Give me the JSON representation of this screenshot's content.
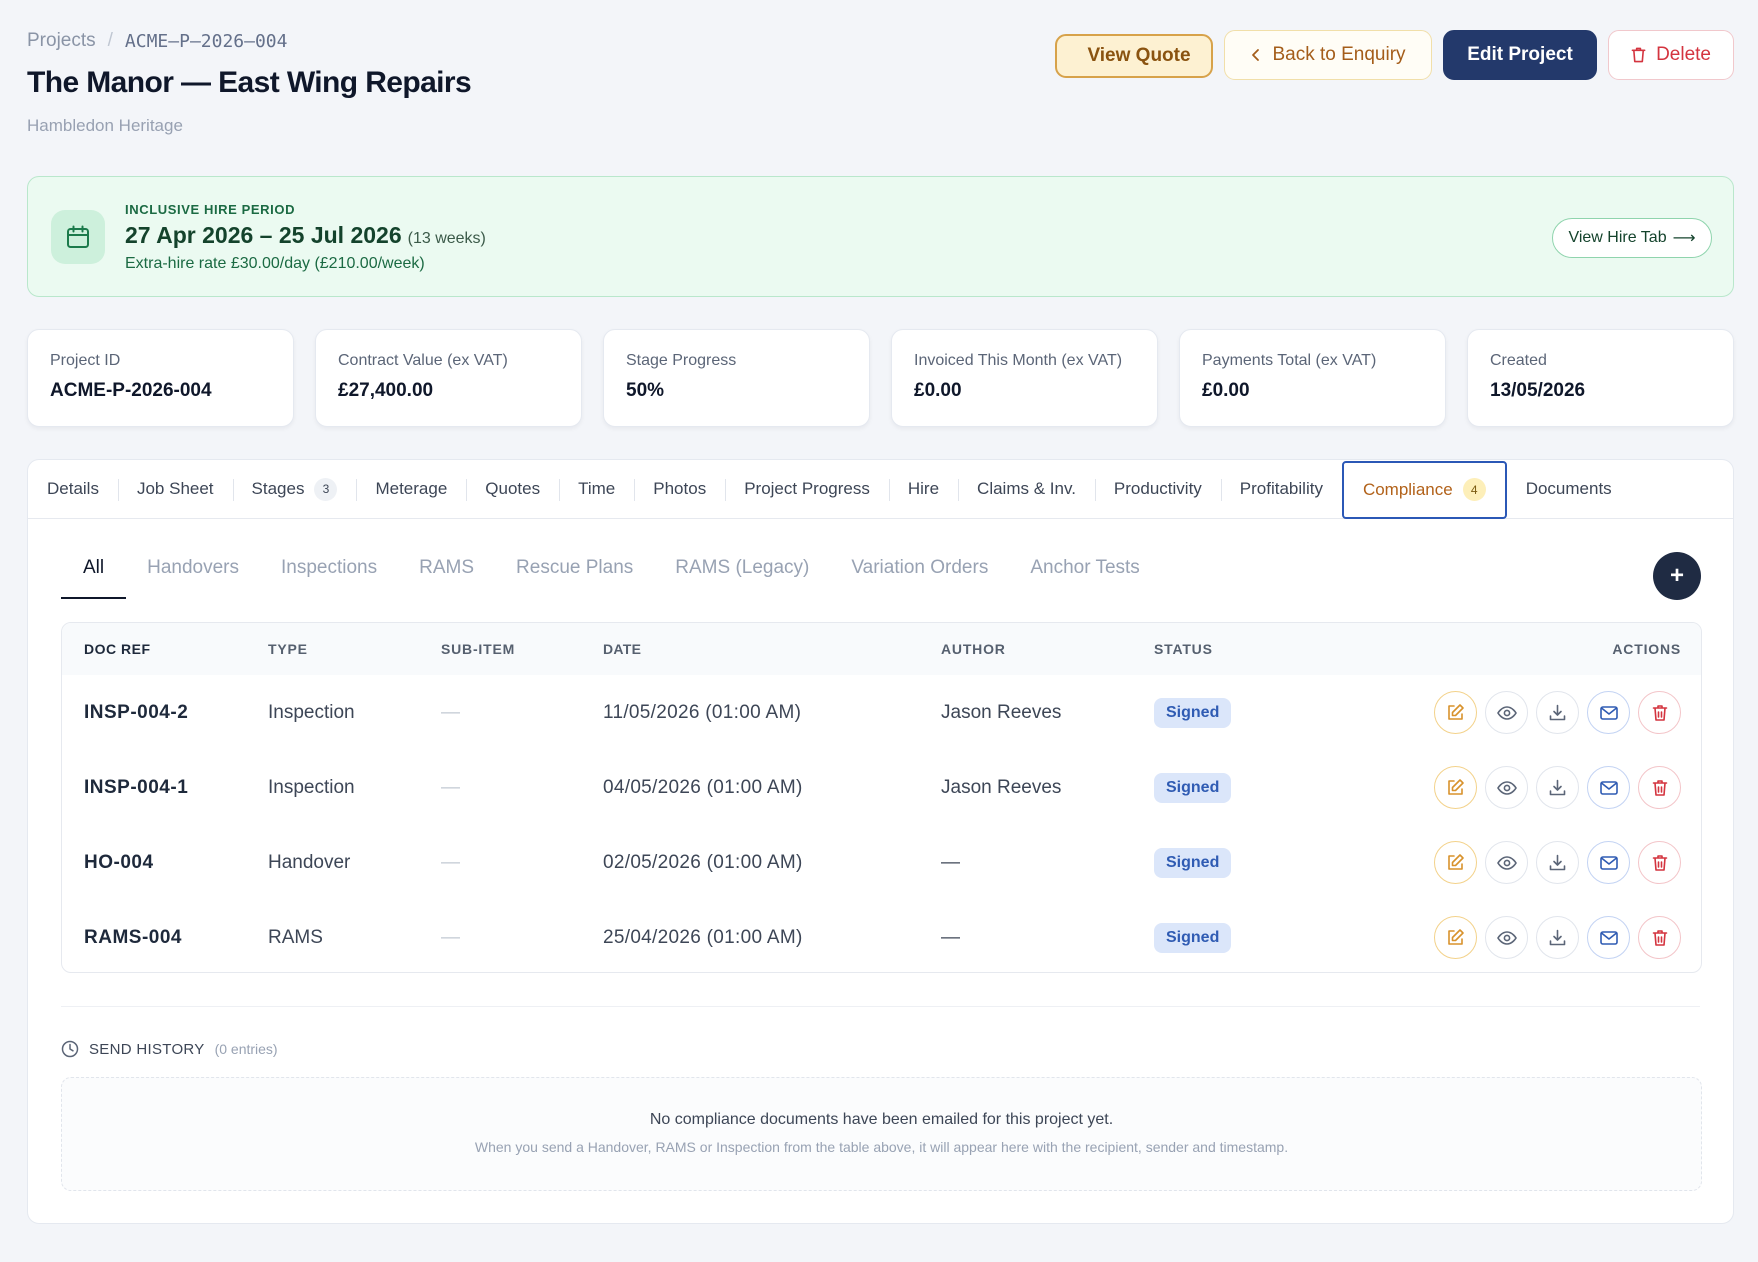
{
  "breadcrumb": {
    "root": "Projects",
    "separator": "/",
    "current": "ACME–P–2026–004"
  },
  "page": {
    "title": "The Manor — East Wing Repairs",
    "subtitle": "Hambledon Heritage"
  },
  "actions": {
    "view_quote": "View Quote",
    "back": "Back to Enquiry",
    "edit": "Edit Project",
    "delete": "Delete"
  },
  "hire": {
    "label": "INCLUSIVE HIRE PERIOD",
    "dates": "27 Apr 2026 – 25 Jul 2026",
    "weeks": "(13 weeks)",
    "rate": "Extra-hire rate £30.00/day (£210.00/week)",
    "button": "View Hire Tab",
    "button_arrow": "⟶"
  },
  "stats": [
    {
      "label": "Project ID",
      "value": "ACME-P-2026-004"
    },
    {
      "label": "Contract Value (ex VAT)",
      "value": "£27,400.00"
    },
    {
      "label": "Stage Progress",
      "value": "50%"
    },
    {
      "label": "Invoiced This Month (ex VAT)",
      "value": "£0.00"
    },
    {
      "label": "Payments Total (ex VAT)",
      "value": "£0.00"
    },
    {
      "label": "Created",
      "value": "13/05/2026"
    }
  ],
  "tabs": [
    {
      "label": "Details"
    },
    {
      "label": "Job Sheet"
    },
    {
      "label": "Stages",
      "count": "3"
    },
    {
      "label": "Meterage"
    },
    {
      "label": "Quotes"
    },
    {
      "label": "Time"
    },
    {
      "label": "Photos"
    },
    {
      "label": "Project Progress"
    },
    {
      "label": "Hire"
    },
    {
      "label": "Claims & Inv."
    },
    {
      "label": "Productivity"
    },
    {
      "label": "Profitability"
    },
    {
      "label": "Compliance",
      "count": "4",
      "active": true
    },
    {
      "label": "Documents"
    }
  ],
  "subtabs": [
    "All",
    "Handovers",
    "Inspections",
    "RAMS",
    "Rescue Plans",
    "RAMS (Legacy)",
    "Variation Orders",
    "Anchor Tests"
  ],
  "add_button": "+",
  "table": {
    "headers": [
      "DOC REF",
      "TYPE",
      "SUB-ITEM",
      "DATE",
      "AUTHOR",
      "STATUS",
      "ACTIONS"
    ],
    "rows": [
      {
        "ref": "INSP-004-2",
        "type": "Inspection",
        "sub": "—",
        "date": "11/05/2026 (01:00 AM)",
        "author": "Jason Reeves",
        "status": "Signed"
      },
      {
        "ref": "INSP-004-1",
        "type": "Inspection",
        "sub": "—",
        "date": "04/05/2026 (01:00 AM)",
        "author": "Jason Reeves",
        "status": "Signed"
      },
      {
        "ref": "HO-004",
        "type": "Handover",
        "sub": "—",
        "date": "02/05/2026 (01:00 AM)",
        "author": "—",
        "status": "Signed"
      },
      {
        "ref": "RAMS-004",
        "type": "RAMS",
        "sub": "—",
        "date": "25/04/2026 (01:00 AM)",
        "author": "—",
        "status": "Signed"
      }
    ]
  },
  "history": {
    "title": "SEND HISTORY",
    "entries": "(0 entries)",
    "empty_main": "No compliance documents have been emailed for this project yet.",
    "empty_sub": "When you send a Handover, RAMS or Inspection from the table above, it will appear here with the recipient, sender and timestamp."
  },
  "colors": {
    "accent": "#23396b",
    "hire_bg": "#ebfaf1",
    "active_tab": "#b2621a",
    "badge": "#dbe6fa",
    "delete": "#d4343f"
  },
  "icons": {
    "quote": "document-icon",
    "back": "chevron-left-icon",
    "delete": "trash-icon",
    "hire": "calendar-icon",
    "history": "clock-icon",
    "row_actions": [
      "edit-icon",
      "eye-icon",
      "download-icon",
      "mail-icon",
      "trash-icon"
    ]
  }
}
